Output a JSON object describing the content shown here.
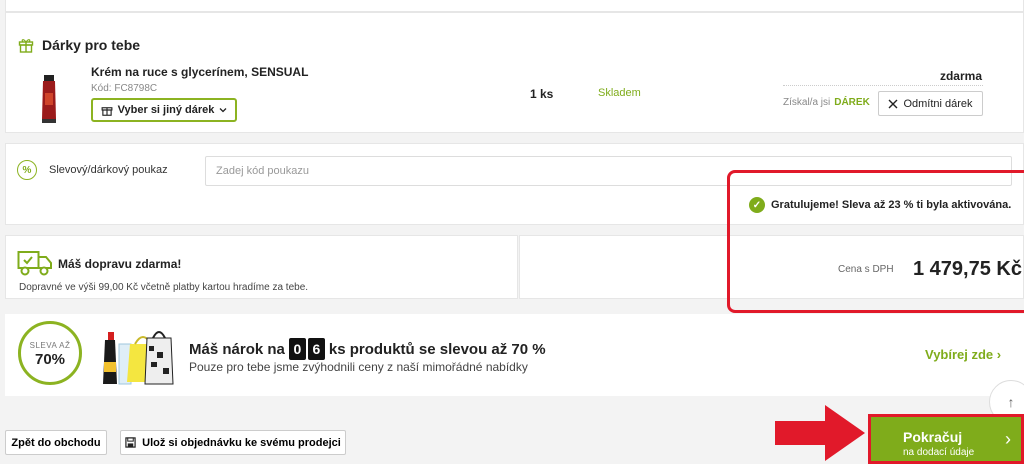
{
  "gifts": {
    "title": "Dárky pro tebe",
    "product_name": "Krém na ruce s glycerínem, SENSUAL",
    "product_code": "Kód: FC8798C",
    "choose_btn": "Vyber si jiný dárek",
    "qty": "1 ks",
    "stock": "Skladem",
    "price": "zdarma",
    "earned_label": "Získal/a jsi",
    "earned_value": "DÁREK",
    "refuse_btn": "Odmítni dárek"
  },
  "coupon": {
    "label": "Slevový/dárkový poukaz",
    "placeholder": "Zadej kód poukazu"
  },
  "shipping": {
    "title": "Máš dopravu zdarma!",
    "subtitle": "Dopravné ve výši 99,00 Kč včetně platby kartou hradíme za tebe."
  },
  "discount_message": "Gratulujeme! Sleva až 23 % ti byla aktivována.",
  "total": {
    "label": "Cena s DPH",
    "value": "1 479,75 Kč"
  },
  "promo": {
    "badge_top": "SLEVA AŽ",
    "badge_pct": "70%",
    "title_prefix": "Máš nárok na",
    "digit_1": "0",
    "digit_2": "6",
    "title_suffix": "ks produktů se slevou až 70 %",
    "subtitle": "Pouze pro tebe jsme zvýhodnili ceny z naší mimořádné nabídky",
    "link": "Vybírej zde ›"
  },
  "bottom": {
    "back_btn": "Zpět do obchodu",
    "save_btn": "Ulož si objednávku ke svému prodejci"
  },
  "continue_btn": {
    "main": "Pokračuj",
    "sub": "na dodací údaje"
  },
  "colors": {
    "accent": "#7fac1b",
    "highlight": "#e1192a"
  }
}
